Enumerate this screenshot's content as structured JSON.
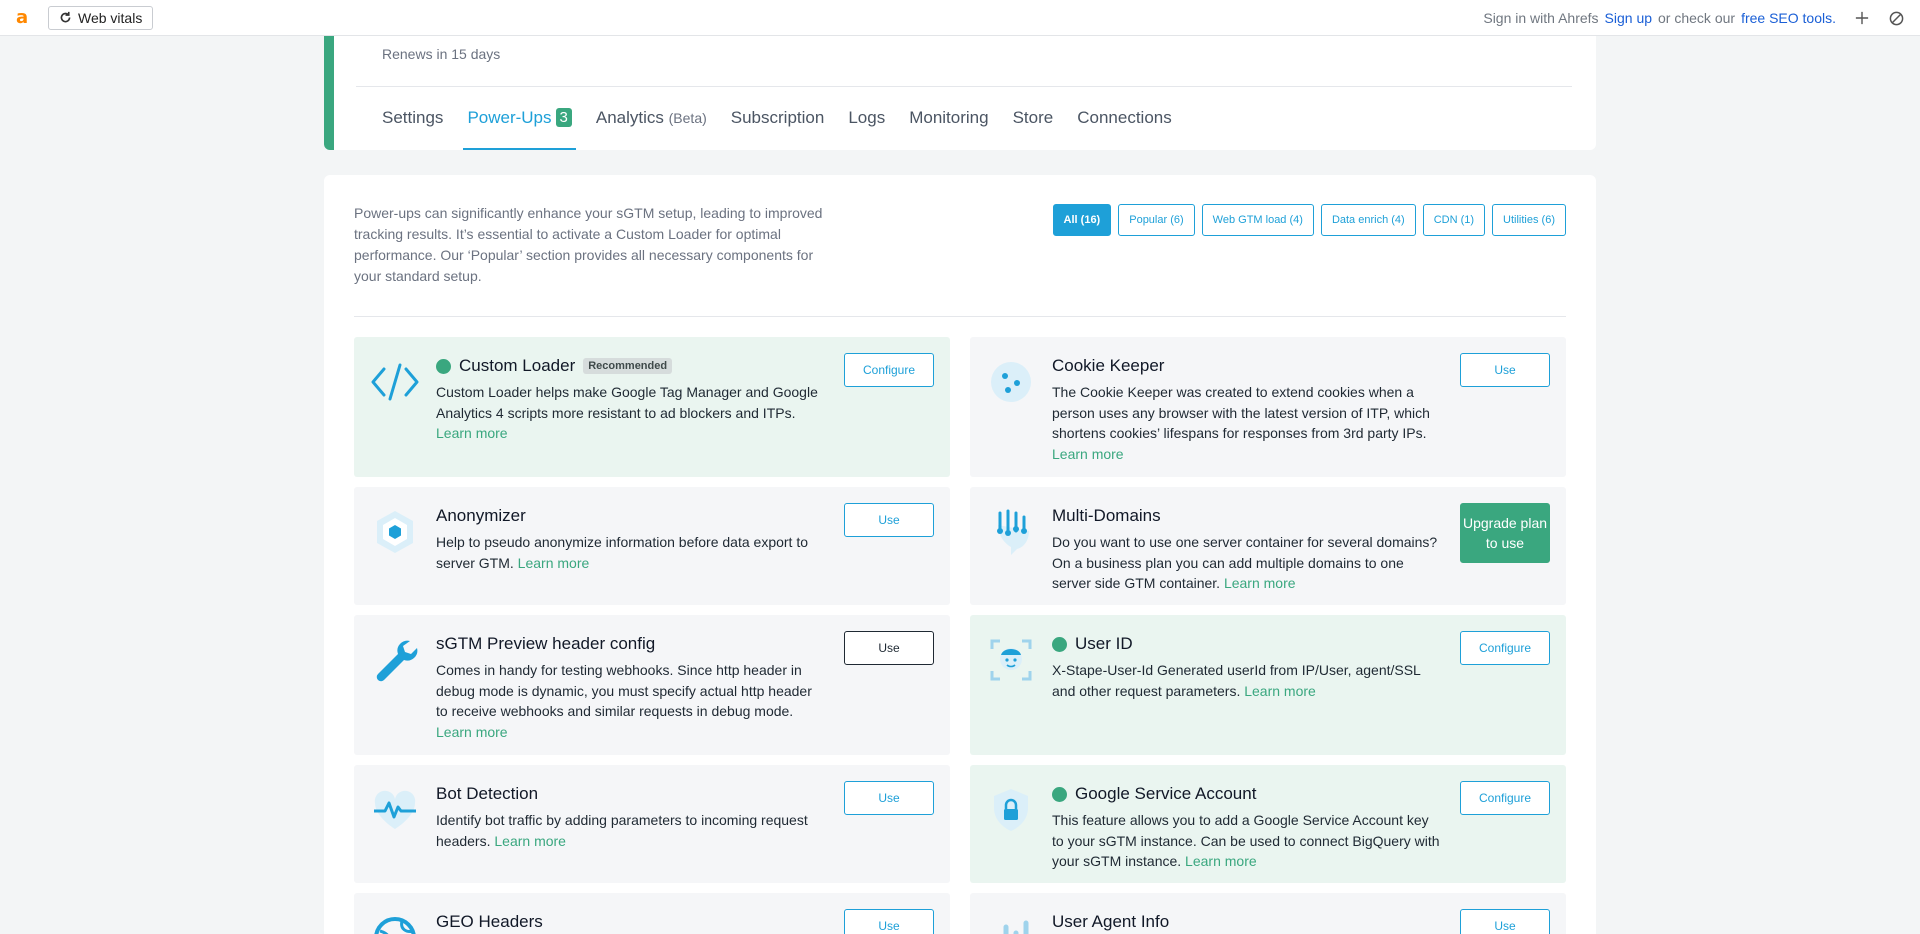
{
  "topbar": {
    "logo": "a",
    "web_vitals": "Web vitals",
    "sign_in": "Sign in with Ahrefs",
    "sign_up": "Sign up",
    "or_check": "or check our",
    "free_tools": "free SEO tools."
  },
  "header": {
    "renews": "Renews in 15 days",
    "tabs": [
      {
        "label": "Settings"
      },
      {
        "label": "Power-Ups",
        "count": "3"
      },
      {
        "label": "Analytics",
        "suffix": "(Beta)"
      },
      {
        "label": "Subscription"
      },
      {
        "label": "Logs"
      },
      {
        "label": "Monitoring"
      },
      {
        "label": "Store"
      },
      {
        "label": "Connections"
      }
    ]
  },
  "intro": "Power-ups can significantly enhance your sGTM setup, leading to improved tracking results. It’s essential to activate a Custom Loader for optimal performance. Our ‘Popular’ section provides all necessary components for your standard setup.",
  "filters": [
    "All (16)",
    "Popular (6)",
    "Web GTM load (4)",
    "Data enrich (4)",
    "CDN (1)",
    "Utilities (6)"
  ],
  "learn_more": "Learn more",
  "cards": [
    {
      "title": "Custom Loader",
      "badge": "Recommended",
      "desc": "Custom Loader helps make Google Tag Manager and Google Analytics 4 scripts more resistant to ad blockers and ITPs.",
      "action": "Configure",
      "icon": "code-icon"
    },
    {
      "title": "Cookie Keeper",
      "desc": "The Cookie Keeper was created to extend cookies when a person uses any browser with the latest version of ITP, which shortens cookies’ lifespans for responses from 3rd party IPs.",
      "action": "Use",
      "icon": "cookie-icon"
    },
    {
      "title": "Anonymizer",
      "desc": "Help to pseudo anonymize information before data export to server GTM.",
      "action": "Use",
      "icon": "hexagon-icon"
    },
    {
      "title": "Multi-Domains",
      "desc": "Do you want to use one server container for several domains? On a business plan you can add multiple domains to one server side GTM container.",
      "action": "Upgrade plan to use",
      "icon": "multi-domain-icon"
    },
    {
      "title": "sGTM Preview header config",
      "desc": "Comes in handy for testing webhooks. Since http header in debug mode is dynamic, you must specify actual http header to receive webhooks and similar requests in debug mode.",
      "action": "Use",
      "icon": "wrench-icon"
    },
    {
      "title": "User ID",
      "desc": "X-Stape-User-Id Generated userId from IP/User, agent/SSL and other request parameters.",
      "action": "Configure",
      "icon": "face-scan-icon"
    },
    {
      "title": "Bot Detection",
      "desc": "Identify bot traffic by adding parameters to incoming request headers.",
      "action": "Use",
      "icon": "heartbeat-icon"
    },
    {
      "title": "Google Service Account",
      "desc": "This feature allows you to add a Google Service Account key to your sGTM instance. Can be used to connect BigQuery with your sGTM instance.",
      "action": "Configure",
      "icon": "shield-lock-icon"
    },
    {
      "title": "GEO Headers",
      "desc": "",
      "action": "Use",
      "icon": "globe-icon"
    },
    {
      "title": "User Agent Info",
      "desc": "",
      "action": "Use",
      "icon": "bar-chart-icon"
    }
  ]
}
